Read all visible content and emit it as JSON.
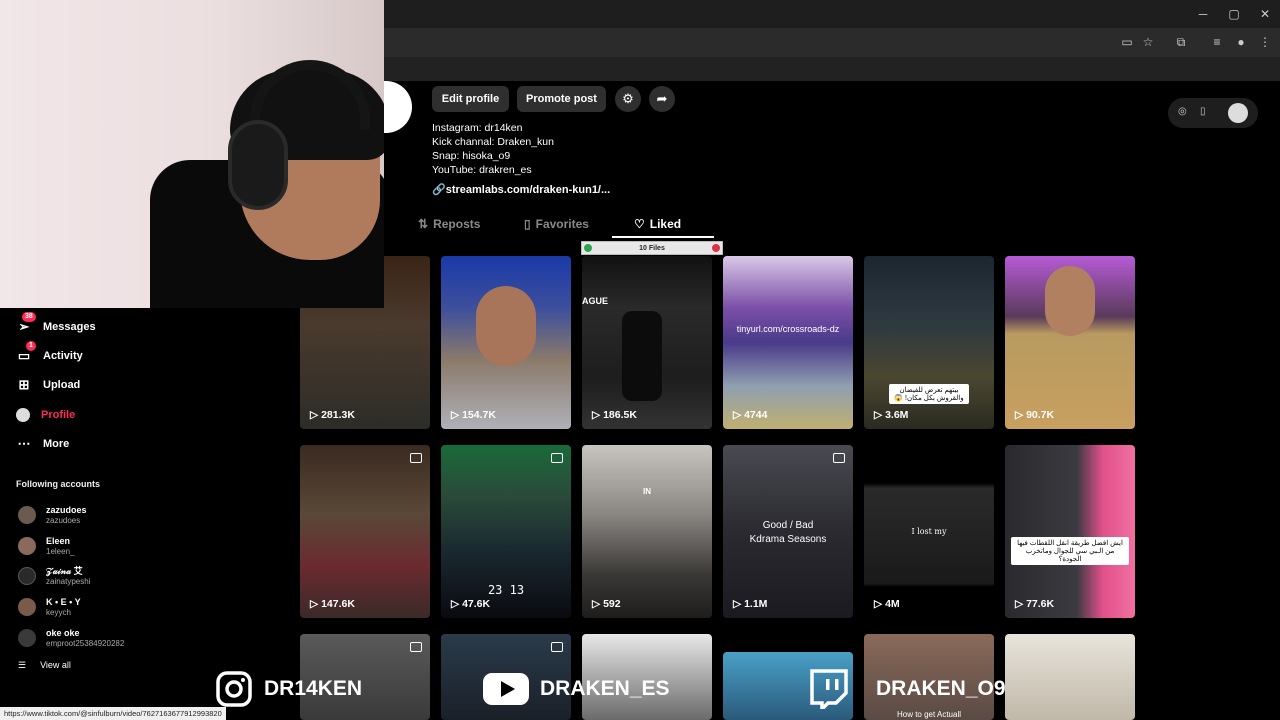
{
  "browser": {
    "window_controls": [
      "─",
      "▢",
      "✕"
    ]
  },
  "profile": {
    "edit_label": "Edit profile",
    "promote_label": "Promote post",
    "bio_lines": [
      "Instagram: dr14ken",
      "Kick channal: Draken_kun",
      "Snap: hisoka_o9",
      "YouTube: drakren_es"
    ],
    "link": "streamlabs.com/draken-kun1/..."
  },
  "tabs": [
    {
      "label": "Reposts",
      "icon": "repost-icon"
    },
    {
      "label": "Favorites",
      "icon": "bookmark-icon"
    },
    {
      "label": "Liked",
      "icon": "heart-icon"
    }
  ],
  "files_overlay": "10 Files",
  "sidebar": {
    "items": [
      {
        "label": "Messages",
        "badge": "38",
        "icon": "paper-plane-icon"
      },
      {
        "label": "Activity",
        "badge": "1",
        "icon": "inbox-icon"
      },
      {
        "label": "Upload",
        "icon": "upload-icon"
      },
      {
        "label": "Profile",
        "icon": "profile-icon"
      },
      {
        "label": "More",
        "icon": "more-icon"
      }
    ],
    "following_title": "Following accounts",
    "accounts": [
      {
        "name": "zazudoes",
        "handle": "zazudoes"
      },
      {
        "name": "Eleen",
        "handle": "1eleen_"
      },
      {
        "name": "𝒵𝒶𝒾𝓃𝒶 艾",
        "handle": "zainatypeshi"
      },
      {
        "name": "K • E • Y",
        "handle": "keyych"
      },
      {
        "name": "oke oke",
        "handle": "emproot25384920282"
      }
    ],
    "view_all": "View all"
  },
  "grid": [
    {
      "views": "281.3K"
    },
    {
      "views": "154.7K"
    },
    {
      "views": "186.5K",
      "caption": "AGUE"
    },
    {
      "views": "4744",
      "caption": "tinyurl.com/crossroads-dz"
    },
    {
      "views": "3.6M",
      "caption": "بيتهم تعرض للفيضان والقروش بكل مكان! 😱"
    },
    {
      "views": "90.7K"
    },
    {
      "views": "147.6K"
    },
    {
      "views": "47.6K",
      "caption": "23 13"
    },
    {
      "views": "592",
      "caption": "IN"
    },
    {
      "views": "1.1M",
      "caption": "Good / Bad\nKdrama Seasons"
    },
    {
      "views": "4M",
      "caption": "I lost my"
    },
    {
      "views": "77.6K",
      "caption": "ايش افضل طريقة انقل اللقطات فيها من الـبي سي للجوال وماتخرب الجودة؟"
    },
    {
      "views": ""
    },
    {
      "views": ""
    },
    {
      "views": ""
    },
    {
      "views": ""
    },
    {
      "views": "",
      "caption": "How to get Actuall"
    },
    {
      "views": ""
    }
  ],
  "socials": {
    "instagram": "DR14KEN",
    "youtube": "DRAKEN_ES",
    "twitch": "DRAKEN_O9"
  },
  "status_url": "https://www.tiktok.com/@sinfulburn/video/7627163677912993820"
}
